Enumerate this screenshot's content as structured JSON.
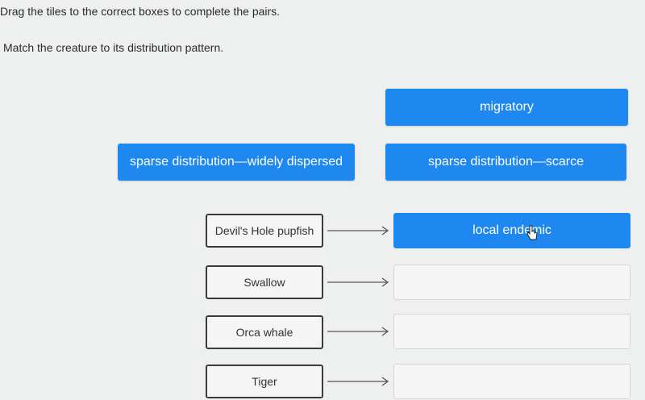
{
  "instructions": {
    "line1": "Drag the tiles to the correct boxes to complete the pairs.",
    "line2": "Match the creature to its distribution pattern."
  },
  "tiles": {
    "migratory": "migratory",
    "scarce": "sparse distribution—scarce",
    "dispersed": "sparse distribution—widely dispersed"
  },
  "pairs": [
    {
      "creature": "Devil's Hole pupfish",
      "answer": "local endemic"
    },
    {
      "creature": "Swallow",
      "answer": ""
    },
    {
      "creature": "Orca whale",
      "answer": ""
    },
    {
      "creature": "Tiger",
      "answer": ""
    }
  ],
  "colors": {
    "tile": "#1e88f0",
    "background": "#eef0ef"
  }
}
